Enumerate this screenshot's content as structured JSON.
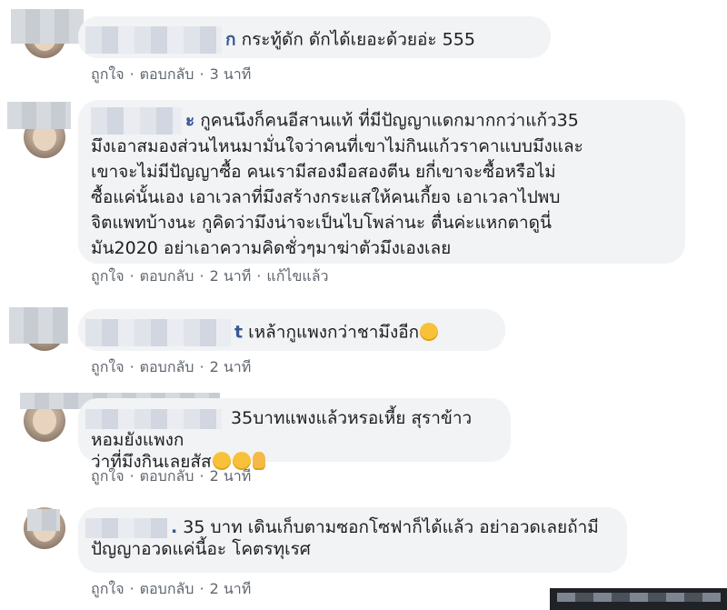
{
  "comments": [
    {
      "name_tail": "ก",
      "text": "กระทู้ดัก ดักได้เยอะด้วยอ่ะ 555",
      "actions": {
        "like": "ถูกใจ",
        "reply": "ตอบกลับ",
        "time": "3 นาที"
      }
    },
    {
      "name_tail": "ะ",
      "lines": [
        "กูคนนึงก็คนอีสานแท้ ที่มีปัญญาแดกมากกว่าแก้ว35",
        "มึงเอาสมองส่วนไหนมามั่นใจว่าคนที่เขาไม่กินแก้วราคาแบบมึงและ",
        "เขาจะไม่มีปัญญาซื้อ คนเรามีสองมือสองตีน ยกี่เขาจะซื้อหรือไม่",
        "ซื้อแค่นั้นเอง เอาเวลาที่มึงสร้างกระแสให้คนเกี้ยจ เอาเวลาไปพบ",
        "จิตแพทบ้างนะ กูคิดว่ามึงน่าจะเป็นไบโพล่านะ ตื่นค่ะแหกตาดูนี่",
        "มัน2020 อย่าเอาความคิดชั่วๆมาฆ่าตัวมึงเองเลย"
      ],
      "actions": {
        "like": "ถูกใจ",
        "reply": "ตอบกลับ",
        "time": "2 นาที",
        "edited": "แก้ไขแล้ว"
      }
    },
    {
      "name_tail": "t",
      "text": "เหล้ากูแพงกว่าชามึงอีก",
      "emoji": [
        "rolling-eyes-emoji"
      ],
      "actions": {
        "like": "ถูกใจ",
        "reply": "ตอบกลับ",
        "time": "2 นาที"
      }
    },
    {
      "name_tail": "",
      "lines": [
        "35บาทแพงแล้วหรอเหี้ย สุราข้าวหอมยังแพงก",
        "ว่าที่มึงกินเลยสัส"
      ],
      "emoji": [
        "sweat-smile-emoji",
        "tears-of-joy-emoji",
        "middle-finger-emoji"
      ],
      "actions": {
        "like": "ถูกใจ",
        "reply": "ตอบกลับ",
        "time": "2 นาที"
      }
    },
    {
      "name_tail": ".",
      "lines": [
        "35 บาท เดินเก็บตามซอกโซฟาก็ได้แล้ว อย่าอวดเลยถ้ามี",
        "ปัญญาอวดแค่นี้อะ โคตรทุเรศ"
      ],
      "actions": {
        "like": "ถูกใจ",
        "reply": "ตอบกลับ",
        "time": "2 นาที"
      }
    }
  ],
  "colors": {
    "bubble": "#f2f3f5",
    "name": "#385898",
    "meta": "#606770"
  }
}
